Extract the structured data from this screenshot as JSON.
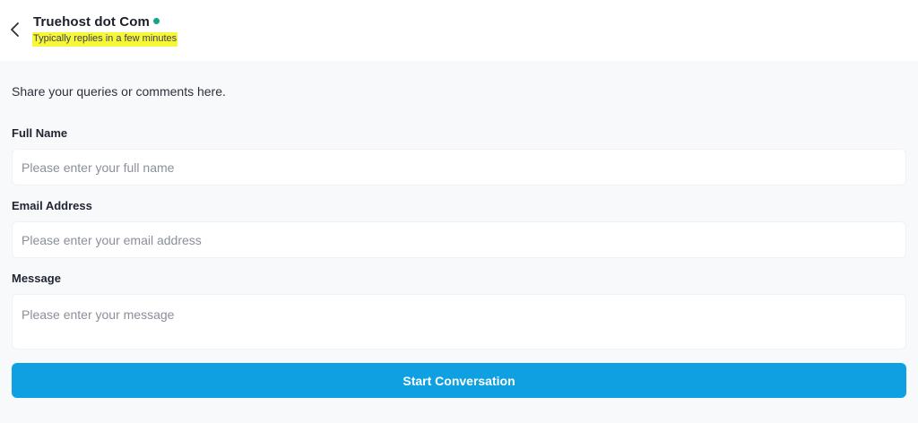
{
  "header": {
    "title": "Truehost dot Com",
    "subtitle": "Typically replies in a few minutes",
    "back_icon": "chevron-left-icon",
    "status": "online"
  },
  "form": {
    "intro": "Share your queries or comments here.",
    "fields": [
      {
        "label": "Full Name",
        "placeholder": "Please enter your full name",
        "value": ""
      },
      {
        "label": "Email Address",
        "placeholder": "Please enter your email address",
        "value": ""
      },
      {
        "label": "Message",
        "placeholder": "Please enter your message",
        "value": ""
      }
    ],
    "submit_label": "Start Conversation"
  },
  "colors": {
    "accent": "#0ea0e0",
    "status_online": "#12a58a",
    "highlight": "#f7f73a",
    "background": "#f8f9fb"
  }
}
